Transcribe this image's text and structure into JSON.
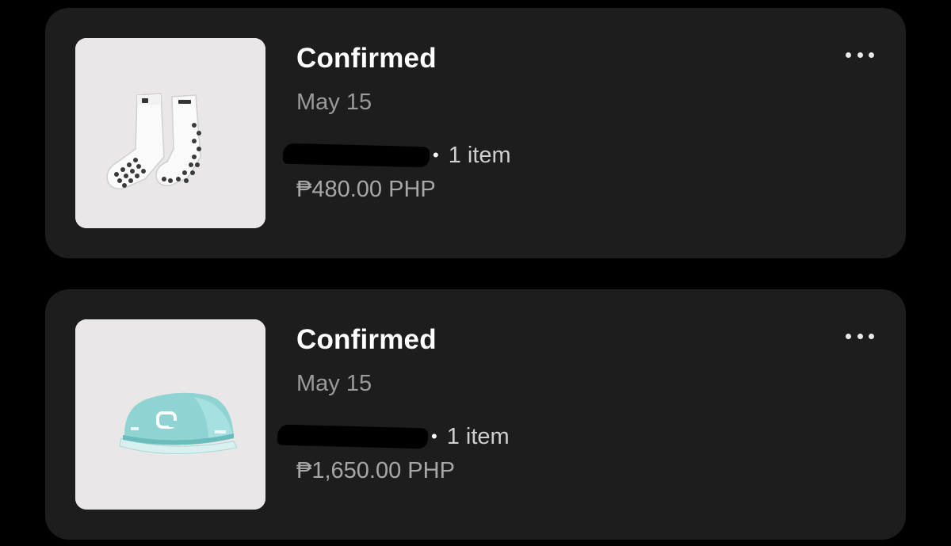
{
  "orders": [
    {
      "status": "Confirmed",
      "date": "May 15",
      "item_count": "1 item",
      "separator": "•",
      "price": "₱480.00 PHP",
      "thumbnail_icon": "socks-product-image",
      "more_icon": "more-horizontal-icon"
    },
    {
      "status": "Confirmed",
      "date": "May 15",
      "item_count": "1 item",
      "separator": "•",
      "price": "₱1,650.00 PHP",
      "thumbnail_icon": "cap-product-image",
      "more_icon": "more-horizontal-icon"
    }
  ],
  "colors": {
    "background": "#000000",
    "card": "#1d1d1d",
    "thumbnail_bg": "#e9e7e7",
    "cap_teal": "#8fd3d3"
  }
}
